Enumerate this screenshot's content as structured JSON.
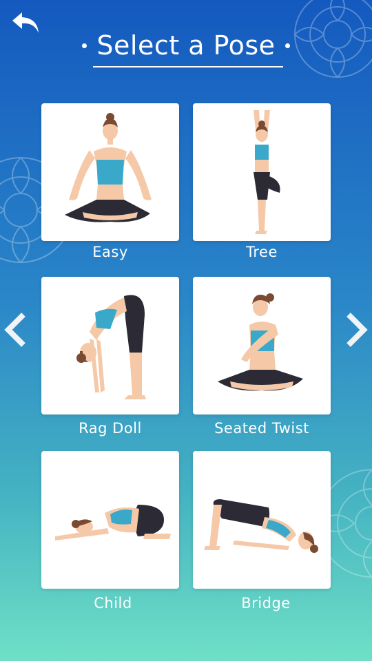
{
  "header": {
    "title": "Select a Pose",
    "back_icon": "back-arrow-icon"
  },
  "navigation": {
    "prev_icon": "chevron-left-icon",
    "next_icon": "chevron-right-icon"
  },
  "poses": [
    {
      "name": "Easy"
    },
    {
      "name": "Tree"
    },
    {
      "name": "Rag Doll"
    },
    {
      "name": "Seated Twist"
    },
    {
      "name": "Child"
    },
    {
      "name": "Bridge"
    }
  ],
  "colors": {
    "gradient_top": "#1459bf",
    "gradient_bottom": "#6fe0c6",
    "skin": "#f5c9a8",
    "top": "#3aa9c9",
    "pants": "#2b2a35",
    "hair": "#7a4a33"
  }
}
